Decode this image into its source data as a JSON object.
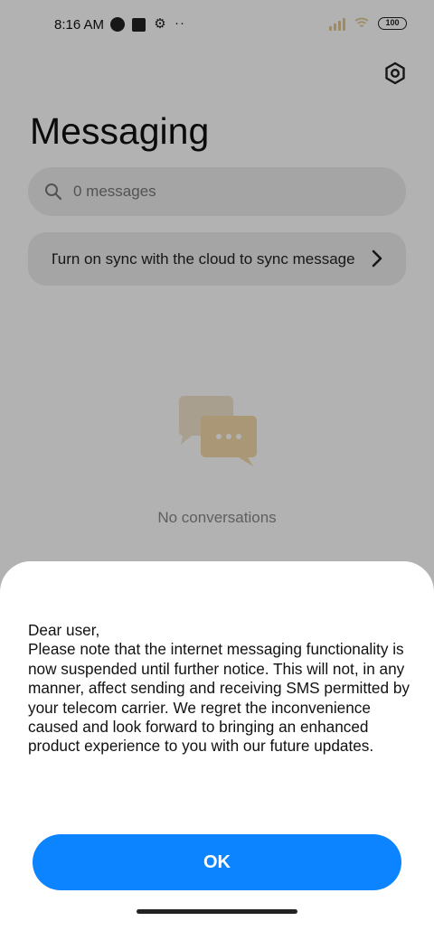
{
  "status_bar": {
    "time": "8:16 AM",
    "battery": "100"
  },
  "header": {
    "title": "Messaging",
    "settings_icon": "settings-hex-icon"
  },
  "search": {
    "placeholder": "0 messages"
  },
  "sync_banner": {
    "text": "Turn on sync with the cloud to sync messages"
  },
  "empty_state": {
    "icon": "chat-bubbles-icon",
    "text": "No conversations"
  },
  "dialog": {
    "message": "Dear user,\nPlease note that the internet messaging functionality is now suspended until further notice. This will not, in any manner, affect sending and receiving SMS permitted by your telecom carrier. We regret the inconvenience caused and look forward to bringing an enhanced product experience to you with our future updates.",
    "ok_label": "OK"
  },
  "colors": {
    "accent": "#0d84ff",
    "illustration_back": "#f1e4cd",
    "illustration_front": "#f3d9a8"
  }
}
